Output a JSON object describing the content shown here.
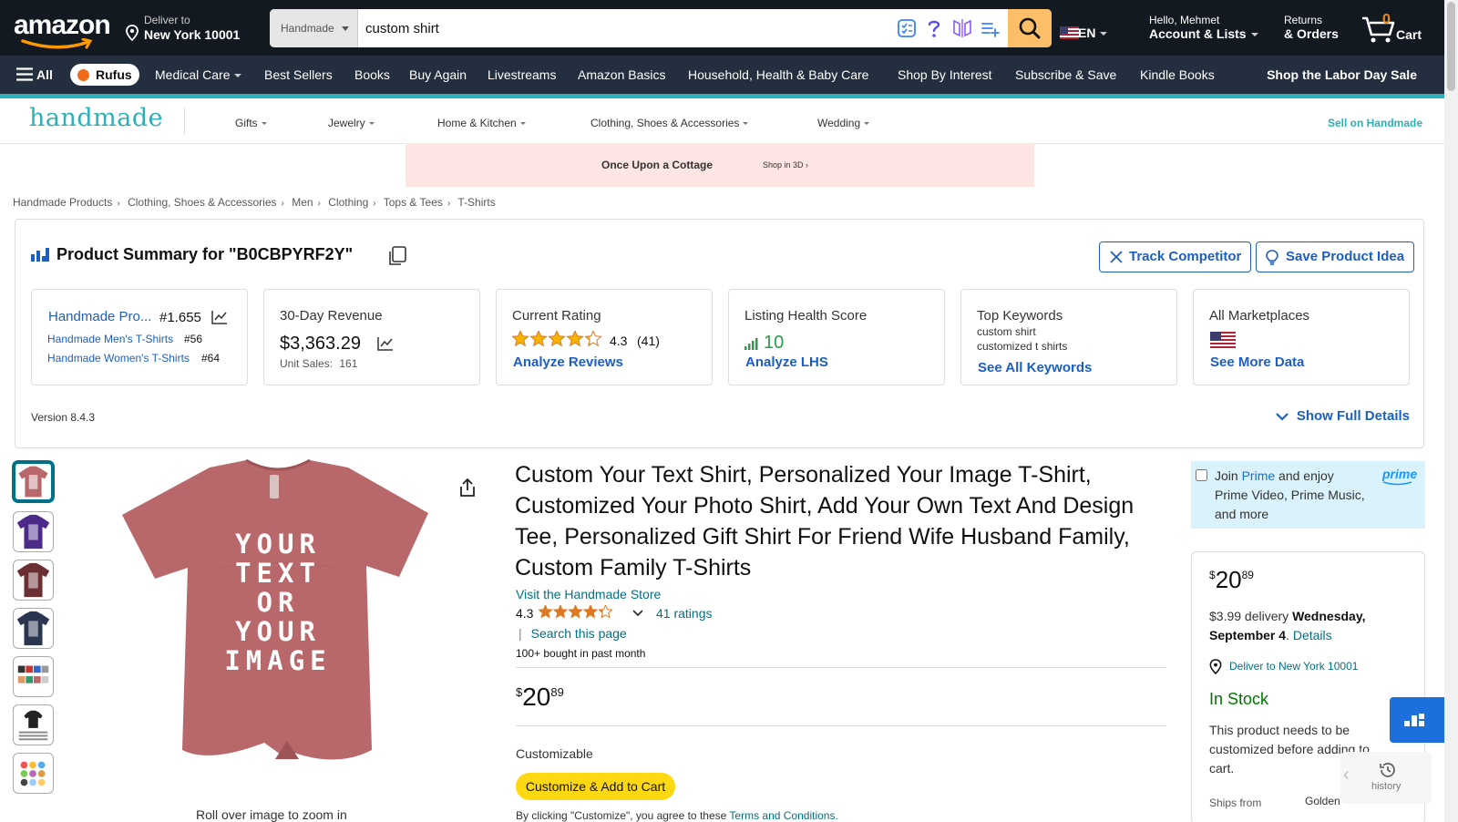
{
  "header": {
    "logo": "amazon",
    "deliver_line1": "Deliver to",
    "deliver_line2": "New York 10001",
    "search_dept": "Handmade",
    "search_value": "custom shirt",
    "lang": "EN",
    "account_line1": "Hello, Mehmet",
    "account_line2": "Account & Lists",
    "orders_line1": "Returns",
    "orders_line2": "& Orders",
    "cart_count": "0",
    "cart_label": "Cart"
  },
  "nav": {
    "all": "All",
    "rufus": "Rufus",
    "items": [
      "Medical Care",
      "Best Sellers",
      "Books",
      "Buy Again",
      "Livestreams",
      "Amazon Basics",
      "Household, Health & Baby Care",
      "Shop By Interest",
      "Subscribe & Save",
      "Kindle Books"
    ],
    "promo": "Shop the Labor Day Sale"
  },
  "handmade": {
    "logo": "handmade",
    "items": [
      "Gifts",
      "Jewelry",
      "Home & Kitchen",
      "Clothing, Shoes & Accessories",
      "Wedding"
    ],
    "sell": "Sell on Handmade"
  },
  "banner": {
    "title": "Once Upon a Cottage",
    "cta": "Shop in 3D ›"
  },
  "breadcrumbs": [
    "Handmade Products",
    "Clothing, Shoes & Accessories",
    "Men",
    "Clothing",
    "Tops & Tees",
    "T-Shirts"
  ],
  "summary": {
    "title": "Product Summary for \"B0CBPYRF2Y\"",
    "track_btn": "Track Competitor",
    "save_btn": "Save Product Idea",
    "rank": {
      "main_label": "Handmade Pro...",
      "main_rank": "#1.655",
      "sub1_label": "Handmade Men's T-Shirts",
      "sub1_rank": "#56",
      "sub2_label": "Handmade Women's T-Shirts",
      "sub2_rank": "#64"
    },
    "revenue": {
      "title": "30-Day Revenue",
      "value": "$3,363.29",
      "units_label": "Unit Sales:",
      "units": "161"
    },
    "rating": {
      "title": "Current Rating",
      "value": "4.3",
      "count": "(41)",
      "link": "Analyze Reviews",
      "stars": 4.3
    },
    "lhs": {
      "title": "Listing Health Score",
      "value": "10",
      "link": "Analyze LHS"
    },
    "keywords": {
      "title": "Top Keywords",
      "kw1": "custom shirt",
      "kw2": "customized t shirts",
      "link": "See All Keywords"
    },
    "marketplaces": {
      "title": "All Marketplaces",
      "link": "See More Data"
    },
    "version": "Version 8.4.3",
    "show_full": "Show Full Details"
  },
  "product": {
    "title": "Custom Your Text Shirt, Personalized Your Image T-Shirt, Customized Your Photo Shirt, Add Your Own Text And Design Tee, Personalized Gift Shirt For Friend Wife Husband Family, Custom Family T-Shirts",
    "store_link": "Visit the Handmade Store",
    "rating": "4.3",
    "ratings_link": "41 ratings",
    "search_page": "Search this page",
    "bought": "100+ bought in past month",
    "price_symbol": "$",
    "price_whole": "20",
    "price_fraction": "89",
    "customizable_label": "Customizable",
    "customize_btn": "Customize & Add to Cart",
    "terms_prefix": "By clicking \"Customize\", you agree to these ",
    "terms_link": "Terms and Conditions.",
    "zoom_note": "Roll over image to zoom in",
    "shirt_text": [
      "YOUR",
      "TEXT",
      "OR",
      "YOUR",
      "IMAGE"
    ],
    "shirt_color": "#b8686a"
  },
  "buybox": {
    "prime_prefix": "Join ",
    "prime_word": "Prime",
    "prime_rest": " and enjoy Prime Video, Prime Music, and more",
    "prime_logo": "prime",
    "price_symbol": "$",
    "price_whole": "20",
    "price_fraction": "89",
    "delivery_prefix": "$3.99 delivery ",
    "delivery_date": "Wednesday, September 4",
    "delivery_details": "Details",
    "deliver_to": "Deliver to New York 10001",
    "stock": "In Stock",
    "note": "This product needs to be customized before adding to cart.",
    "ships_from_label": "Ships from",
    "ships_from_value": "Golden"
  },
  "history": {
    "label": "history"
  }
}
